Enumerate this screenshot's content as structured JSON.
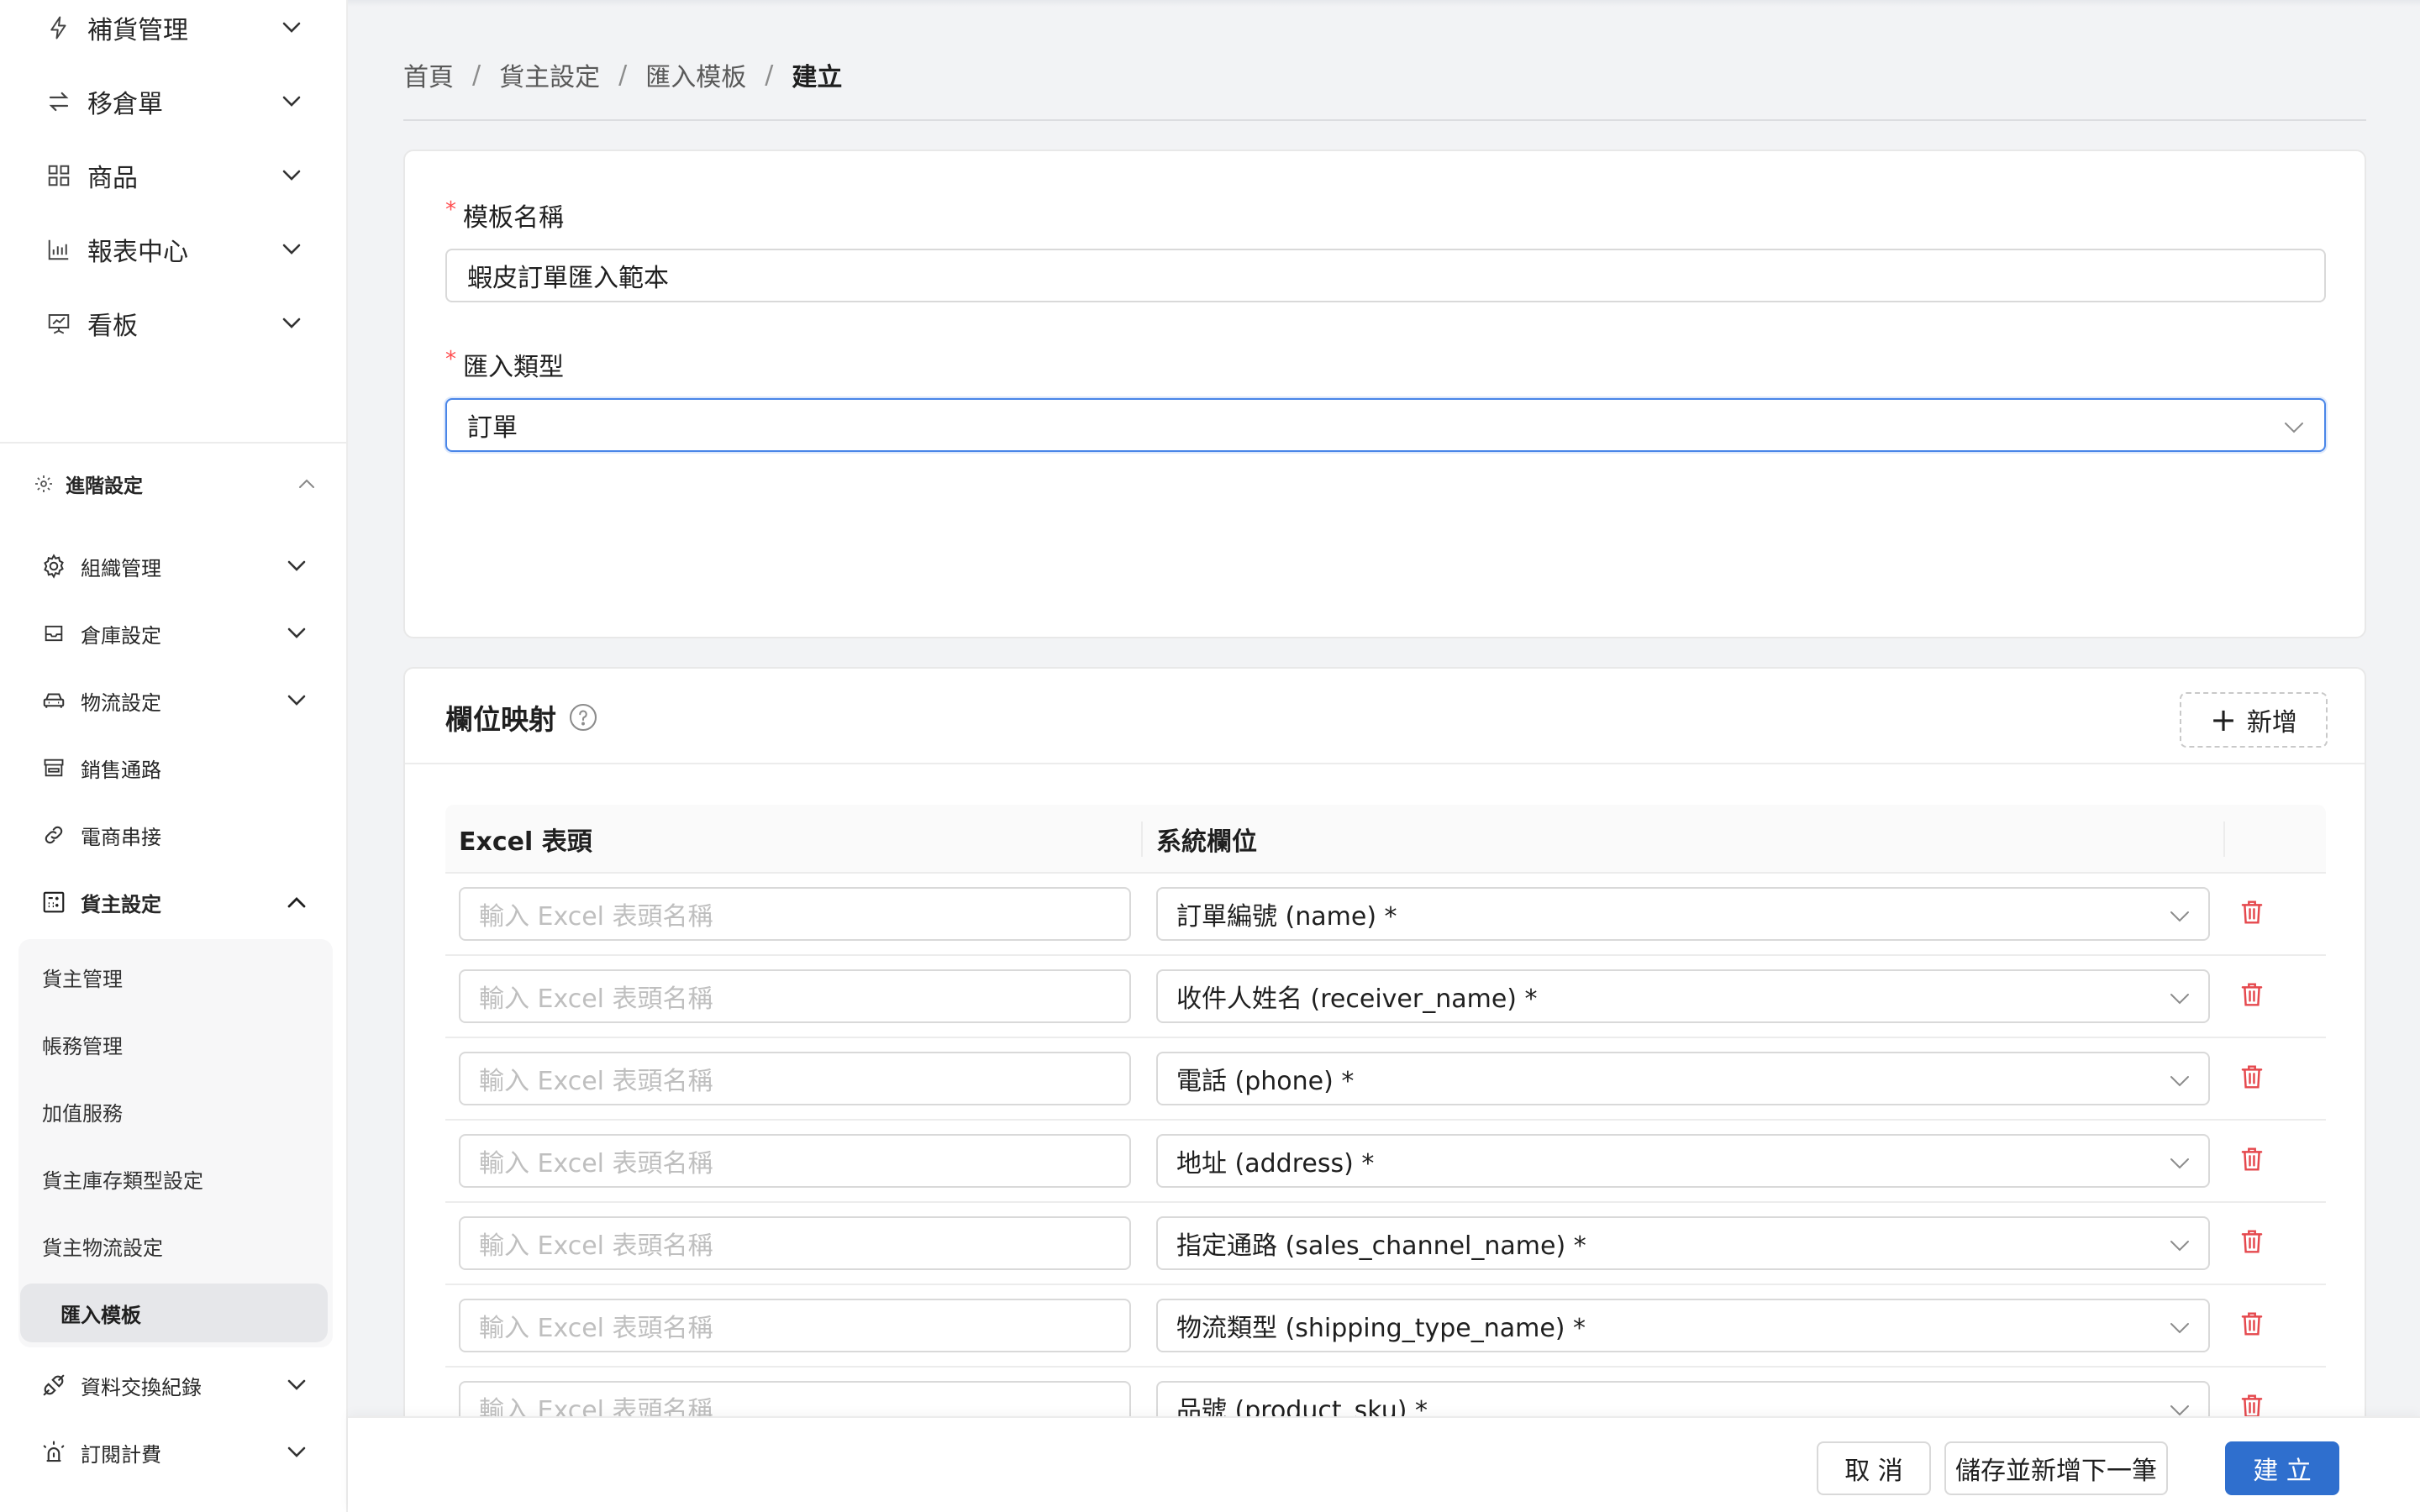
{
  "sidebar": {
    "top_items": [
      {
        "label": "補貨管理",
        "icon": "lightning-icon"
      },
      {
        "label": "移倉單",
        "icon": "transfer-arrows-icon"
      },
      {
        "label": "商品",
        "icon": "grid-icon"
      },
      {
        "label": "報表中心",
        "icon": "bar-chart-icon"
      },
      {
        "label": "看板",
        "icon": "presentation-icon"
      }
    ],
    "section_title": "進階設定",
    "advanced_items": [
      {
        "label": "組織管理",
        "icon": "gear-icon"
      },
      {
        "label": "倉庫設定",
        "icon": "inbox-icon"
      },
      {
        "label": "物流設定",
        "icon": "car-icon"
      },
      {
        "label": "銷售通路",
        "icon": "shop-icon"
      },
      {
        "label": "電商串接",
        "icon": "link-icon"
      },
      {
        "label": "貨主設定",
        "icon": "calculator-icon"
      }
    ],
    "sub_items": [
      "貨主管理",
      "帳務管理",
      "加值服務",
      "貨主庫存類型設定",
      "貨主物流設定",
      "匯入模板"
    ],
    "bottom_items": [
      {
        "label": "資料交換紀錄",
        "icon": "api-icon"
      },
      {
        "label": "訂閱計費",
        "icon": "alarm-icon"
      }
    ]
  },
  "breadcrumb": {
    "home": "首頁",
    "level1": "貨主設定",
    "level2": "匯入模板",
    "current": "建立",
    "separator": "/"
  },
  "form": {
    "required_mark": "*",
    "template_name_label": "模板名稱",
    "template_name_value": "蝦皮訂單匯入範本",
    "import_type_label": "匯入類型",
    "import_type_value": "訂單"
  },
  "mapping": {
    "title": "欄位映射",
    "add_label": "新增",
    "col_excel": "Excel 表頭",
    "col_system": "系統欄位",
    "excel_placeholder": "輸入 Excel 表頭名稱",
    "rows": [
      {
        "system_field": "訂單編號 (name) *"
      },
      {
        "system_field": "收件人姓名 (receiver_name) *"
      },
      {
        "system_field": "電話 (phone) *"
      },
      {
        "system_field": "地址 (address) *"
      },
      {
        "system_field": "指定通路 (sales_channel_name) *"
      },
      {
        "system_field": "物流類型 (shipping_type_name) *"
      },
      {
        "system_field": "品號 (product_sku) *"
      }
    ]
  },
  "footer": {
    "cancel": "取 消",
    "save_next": "儲存並新增下一筆",
    "create": "建 立"
  },
  "colors": {
    "primary": "#2f6fce",
    "danger": "#e5484d",
    "focus_border": "#4a86e8"
  }
}
